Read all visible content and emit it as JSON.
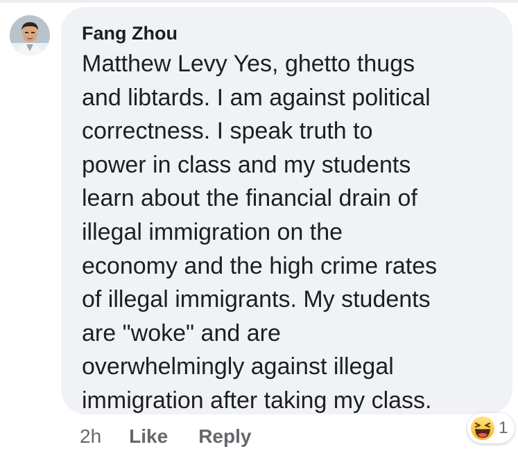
{
  "comment": {
    "author": "Fang Zhou",
    "text_lines": [
      "Matthew Levy Yes, ghetto thugs",
      "and libtards. I am against political",
      "correctness. I speak truth to",
      "power in class and my students",
      "learn about the financial drain of",
      "illegal immigration on the",
      "economy and the high crime rates",
      "of illegal immigrants. My students",
      "are \"woke\" and are",
      "overwhelmingly against illegal",
      "immigration after taking my class."
    ],
    "timestamp": "2h",
    "like_label": "Like",
    "reply_label": "Reply",
    "reaction": {
      "icon": "haha-emoji-icon",
      "count": "1"
    }
  },
  "colors": {
    "bubble_bg": "#f0f2f5",
    "text": "#1c1e21",
    "secondary_text": "#65676b"
  }
}
